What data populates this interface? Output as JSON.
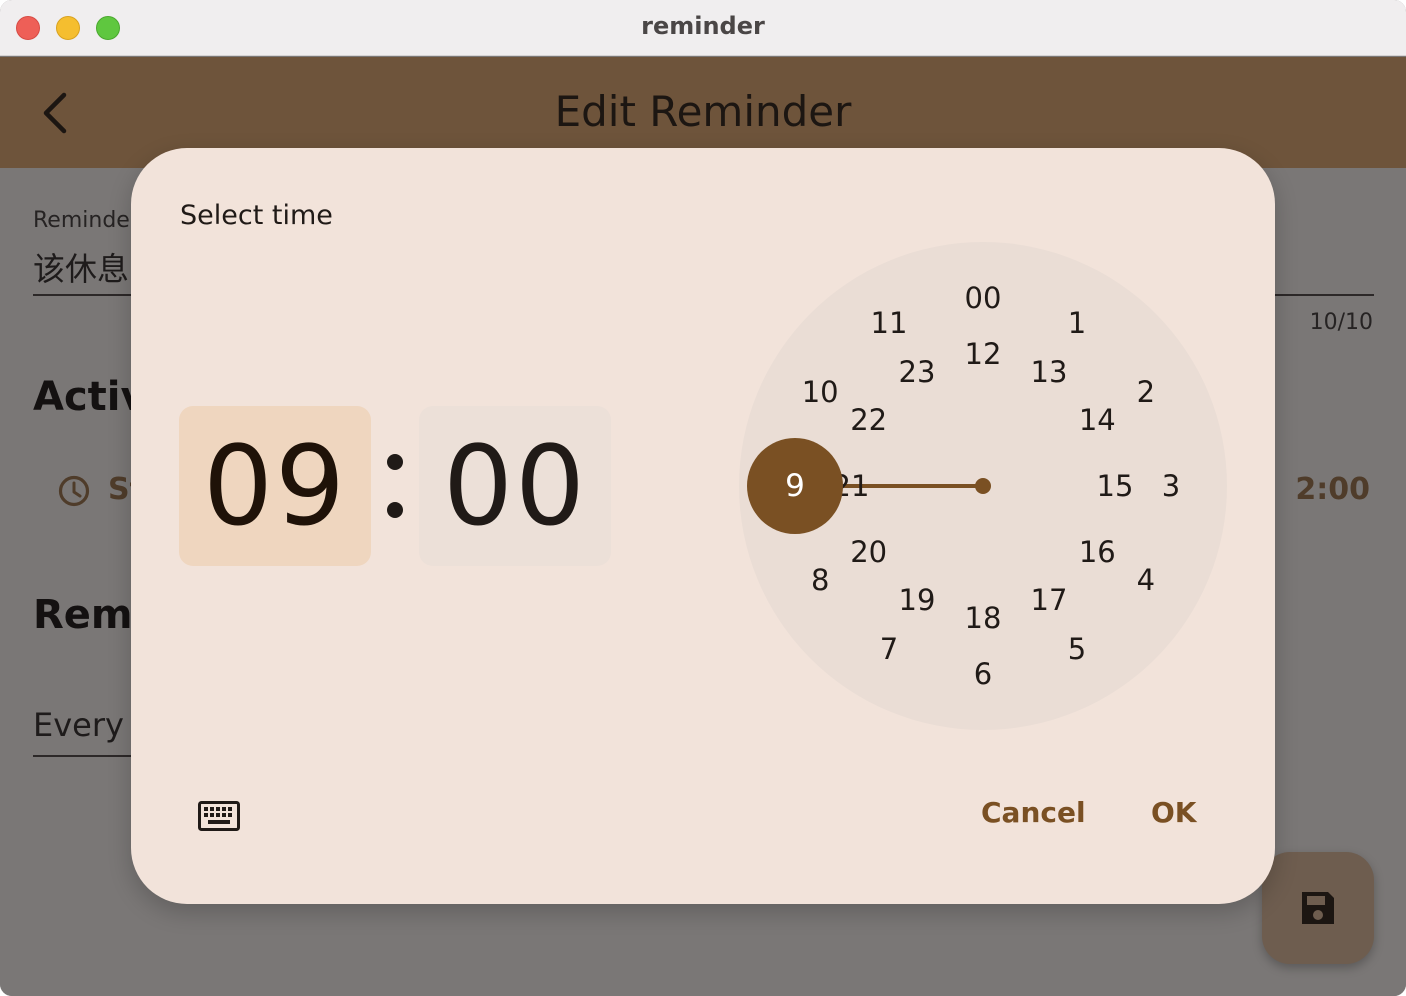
{
  "window": {
    "title": "reminder"
  },
  "appbar": {
    "title": "Edit Reminder",
    "back_icon": "chevron-left-icon"
  },
  "form": {
    "reminder_label": "Reminde",
    "reminder_value": "该休息",
    "counter": "10/10",
    "active_heading": "Activ",
    "start_label": "St",
    "end_time": "2:00",
    "reminder_heading": "Remi",
    "every_label": "Every"
  },
  "fab": {
    "icon": "save-icon"
  },
  "dialog": {
    "title": "Select time",
    "hour": "09",
    "minute": "00",
    "selected_value": "9",
    "outer_numbers": [
      "00",
      "1",
      "2",
      "3",
      "4",
      "5",
      "6",
      "7",
      "8",
      "9",
      "10",
      "11"
    ],
    "inner_numbers": [
      "12",
      "13",
      "14",
      "15",
      "16",
      "17",
      "18",
      "19",
      "20",
      "21",
      "22",
      "23"
    ],
    "cancel_label": "Cancel",
    "ok_label": "OK",
    "keyboard_icon": "keyboard-icon"
  },
  "colors": {
    "appbar": "#6e543b",
    "accent": "#7a5023",
    "dialog_bg": "#f2e3da",
    "hour_box": "#efd6bf",
    "minute_box": "#ece0d8",
    "dial_bg": "#eaddd5"
  }
}
